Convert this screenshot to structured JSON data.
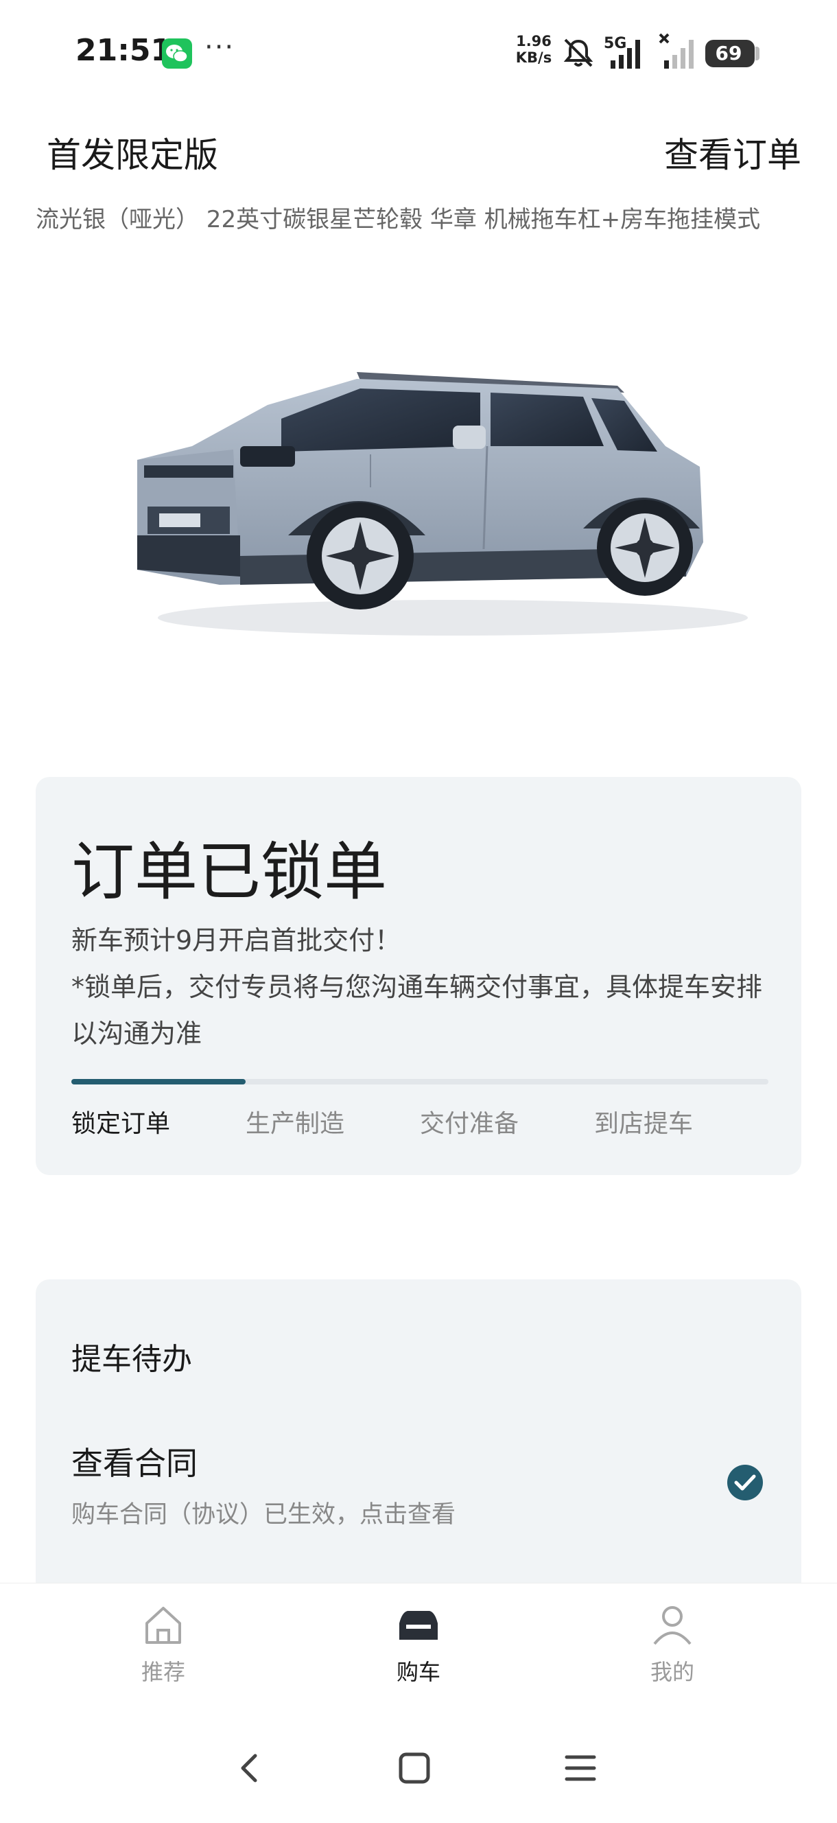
{
  "status_bar": {
    "time": "21:51",
    "net_speed_value": "1.96",
    "net_speed_unit": "KB/s",
    "network_label": "5G",
    "battery": "69",
    "icons": [
      "wechat-icon",
      "more-dots-icon",
      "mute-bell-icon",
      "signal-5g-icon",
      "signal-icon",
      "battery-icon"
    ]
  },
  "header": {
    "title": "首发限定版",
    "link": "查看订单"
  },
  "config_summary": "流光银（哑光） 22英寸碳银星芒轮毂 华章 机械拖车杠+房车拖挂模式",
  "order_status": {
    "title": "订单已锁单",
    "line1": "新车预计9月开启首批交付！",
    "line2": "*锁单后，交付专员将与您沟通车辆交付事宜，具体提车安排以沟通为准",
    "progress": 0.25,
    "steps": [
      "锁定订单",
      "生产制造",
      "交付准备",
      "到店提车"
    ],
    "active_step": 0,
    "accent_color": "#245d70"
  },
  "pickup_todo": {
    "title": "提车待办",
    "item_title": "查看合同",
    "item_subtitle": "购车合同（协议）已生效，点击查看",
    "item_done": true
  },
  "bottom_nav": {
    "items": [
      {
        "label": "推荐",
        "icon": "home-icon",
        "active": false
      },
      {
        "label": "购车",
        "icon": "car-icon",
        "active": true
      },
      {
        "label": "我的",
        "icon": "user-icon",
        "active": false
      }
    ]
  },
  "system_nav": {
    "icons": [
      "back-icon",
      "home-square-icon",
      "menu-icon"
    ]
  }
}
